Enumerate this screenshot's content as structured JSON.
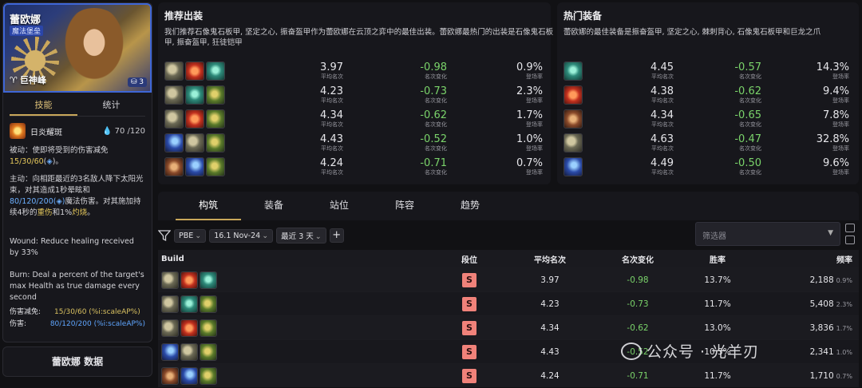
{
  "champion": {
    "name": "蕾欧娜",
    "role": "魔法堡垒",
    "trait": "巨神峰",
    "cost": "3"
  },
  "left_tabs": [
    "技能",
    "统计"
  ],
  "skill": {
    "name": "日炎耀斑",
    "mana_current": "70",
    "mana_max": "/120",
    "passive_prefix": "被动：使即将受到的伤害减免",
    "passive_values": "15/30/60",
    "passive_suffix": "(",
    "passive_end": ")。",
    "active_prefix": "主动：向相距最近的3名敌人降下太阳光束，对其造成1秒晕眩和",
    "active_values": "80/120/200",
    "active_mid": "魔法伤害。对其施加持续4秒的",
    "active_wound": "重伤",
    "active_and": "和1%",
    "active_burn": "灼烧",
    "active_end": "。",
    "wound_text": "Wound: Reduce healing received by 33%",
    "burn_text": "Burn: Deal a percent of the target's max Health as true damage every second",
    "stats": [
      {
        "label": "伤害减免:",
        "value": "15/30/60",
        "suffix": "(%i:scaleAP%)"
      },
      {
        "label": "伤害:",
        "value": "80/120/200",
        "suffix": "(%i:scaleAP%)"
      }
    ]
  },
  "left_bottom_title": "蕾欧娜 数据",
  "recommended": {
    "title": "推荐出装",
    "desc": "我们推荐石像鬼石板甲, 坚定之心, 振奋盔甲作为蕾欧娜在云顶之弈中的最佳出装。蕾欧娜最热门的出装是石像鬼石板甲, 振奋盔甲, 狂徒铠甲",
    "rows": [
      {
        "icons": [
          "a",
          "b",
          "c"
        ],
        "avg": "3.97",
        "chg": "-0.98",
        "rate": "0.9%"
      },
      {
        "icons": [
          "a",
          "c",
          "d"
        ],
        "avg": "4.23",
        "chg": "-0.73",
        "rate": "2.3%"
      },
      {
        "icons": [
          "a",
          "b",
          "d"
        ],
        "avg": "4.34",
        "chg": "-0.62",
        "rate": "1.7%"
      },
      {
        "icons": [
          "e",
          "a",
          "d"
        ],
        "avg": "4.43",
        "chg": "-0.52",
        "rate": "1.0%"
      },
      {
        "icons": [
          "f",
          "e",
          "d"
        ],
        "avg": "4.24",
        "chg": "-0.71",
        "rate": "0.7%"
      }
    ]
  },
  "hot": {
    "title": "热门装备",
    "desc": "蕾欧娜的最佳装备是振奋盔甲, 坚定之心, 棘刺背心, 石像鬼石板甲和巨龙之爪",
    "rows": [
      {
        "icons": [
          "c"
        ],
        "avg": "4.45",
        "chg": "-0.57",
        "rate": "14.3%"
      },
      {
        "icons": [
          "b"
        ],
        "avg": "4.38",
        "chg": "-0.62",
        "rate": "9.4%"
      },
      {
        "icons": [
          "f"
        ],
        "avg": "4.34",
        "chg": "-0.65",
        "rate": "7.8%"
      },
      {
        "icons": [
          "a"
        ],
        "avg": "4.63",
        "chg": "-0.47",
        "rate": "32.8%"
      },
      {
        "icons": [
          "e"
        ],
        "avg": "4.49",
        "chg": "-0.50",
        "rate": "9.6%"
      }
    ]
  },
  "small_labels": {
    "avg": "平均名次",
    "chg": "名次变化",
    "rate": "登场率"
  },
  "main_tabs": [
    "构筑",
    "装备",
    "站位",
    "阵容",
    "趋势"
  ],
  "filters": {
    "set": "PBE",
    "patch": "16.1 Nov-24",
    "range": "最近 3 天",
    "plus": "+",
    "placeholder": "筛选器"
  },
  "table": {
    "headers": [
      "Build",
      "段位",
      "平均名次",
      "名次变化",
      "胜率",
      "频率"
    ],
    "rows": [
      {
        "icons": [
          "a",
          "b",
          "c"
        ],
        "tier": "S",
        "avg": "3.97",
        "chg": "-0.98",
        "win": "13.7%",
        "freq": "2,188",
        "freq_pct": "0.9%"
      },
      {
        "icons": [
          "a",
          "c",
          "d"
        ],
        "tier": "S",
        "avg": "4.23",
        "chg": "-0.73",
        "win": "11.7%",
        "freq": "5,408",
        "freq_pct": "2.3%"
      },
      {
        "icons": [
          "a",
          "b",
          "d"
        ],
        "tier": "S",
        "avg": "4.34",
        "chg": "-0.62",
        "win": "13.0%",
        "freq": "3,836",
        "freq_pct": "1.7%"
      },
      {
        "icons": [
          "e",
          "a",
          "d"
        ],
        "tier": "S",
        "avg": "4.43",
        "chg": "-0.52",
        "win": "10.3%",
        "freq": "2,341",
        "freq_pct": "1.0%"
      },
      {
        "icons": [
          "f",
          "e",
          "d"
        ],
        "tier": "S",
        "avg": "4.24",
        "chg": "-0.71",
        "win": "11.7%",
        "freq": "1,710",
        "freq_pct": "0.7%"
      }
    ]
  },
  "watermark": "公众号 · 光羊刃"
}
